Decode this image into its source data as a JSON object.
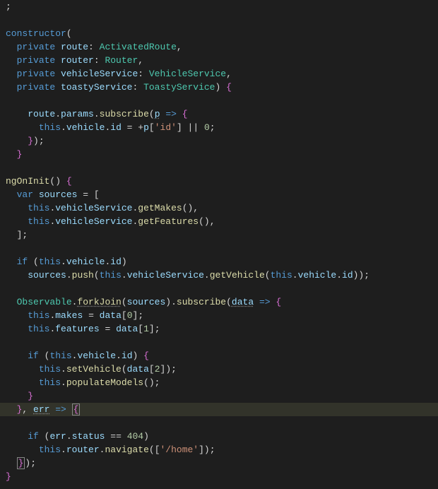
{
  "code": {
    "l0": ";",
    "constructor_kw": "constructor",
    "private_kw": "private",
    "route": "route",
    "ActivatedRoute": "ActivatedRoute",
    "router": "router",
    "Router": "Router",
    "vehicleService": "vehicleService",
    "VehicleService": "VehicleService",
    "toastyService": "toastyService",
    "ToastyService": "ToastyService",
    "params": "params",
    "subscribe": "subscribe",
    "p": "p",
    "this_kw": "this",
    "vehicle": "vehicle",
    "id": "id",
    "id_str": "'id'",
    "zero": "0",
    "ngOnInit": "ngOnInit",
    "var_kw": "var",
    "sources": "sources",
    "getMakes": "getMakes",
    "getFeatures": "getFeatures",
    "if_kw": "if",
    "push": "push",
    "getVehicle": "getVehicle",
    "Observable": "Observable",
    "forkJoin": "forkJoin",
    "data": "data",
    "makes": "makes",
    "features": "features",
    "n0": "0",
    "n1": "1",
    "n2": "2",
    "setVehicle": "setVehicle",
    "populateModels": "populateModels",
    "err": "err",
    "status": "status",
    "n404": "404",
    "navigate": "navigate",
    "home_str": "'/home'"
  }
}
